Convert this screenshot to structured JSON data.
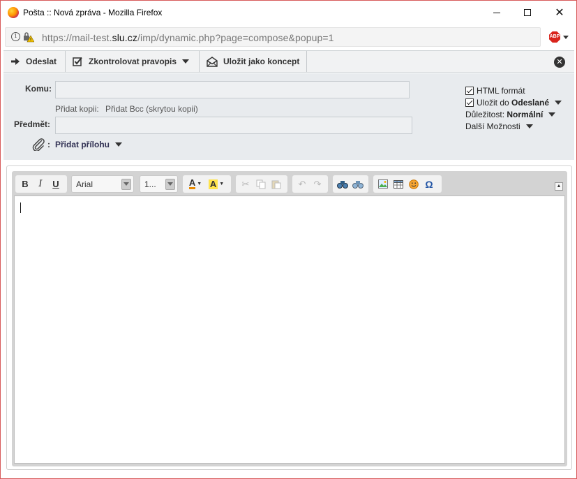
{
  "window": {
    "title": "Pošta :: Nová zpráva - Mozilla Firefox",
    "minimize_icon": "minimize-icon",
    "maximize_icon": "maximize-icon",
    "close_glyph": "✕"
  },
  "urlbar": {
    "prefix": "https://mail-test.",
    "domain": "slu.cz",
    "suffix": "/imp/dynamic.php?page=compose&popup=1",
    "info_glyph": "i",
    "adblock_label": "ABP"
  },
  "toolbar": {
    "send_label": "Odeslat",
    "spell_label": "Zkontrolovat pravopis",
    "draft_label": "Uložit jako koncept",
    "close_glyph": "✕"
  },
  "headers": {
    "to_label": "Komu:",
    "to_value": "",
    "add_cc": "Přidat kopii:",
    "add_bcc": "Přidat Bcc (skrytou kopii)",
    "subject_label": "Předmět:",
    "subject_value": "",
    "attach_colon": ":",
    "attach_label": "Přidat přílohu"
  },
  "options": {
    "html_format_label": "HTML formát",
    "html_format_checked": true,
    "save_to_prefix": "Uložit do ",
    "save_to_folder": "Odeslané",
    "save_to_checked": true,
    "priority_prefix": "Důležitost: ",
    "priority_value": "Normální",
    "more_options": "Další Možnosti"
  },
  "editor": {
    "bold": "B",
    "italic": "I",
    "underline": "U",
    "font_value": "Arial",
    "size_value": "1...",
    "text_color_glyph": "A",
    "bg_color_glyph": "A",
    "cut_glyph": "✂",
    "undo_glyph": "↶",
    "redo_glyph": "↷",
    "special_char_glyph": "Ω",
    "collapse_glyph": "▲",
    "body_text": ""
  },
  "colors": {
    "accent": "#335",
    "window_border": "#d85a5a",
    "toolbar_bg": "#f1f2f3",
    "header_bg": "#e8ebee",
    "editor_frame": "#d3d3d3"
  }
}
